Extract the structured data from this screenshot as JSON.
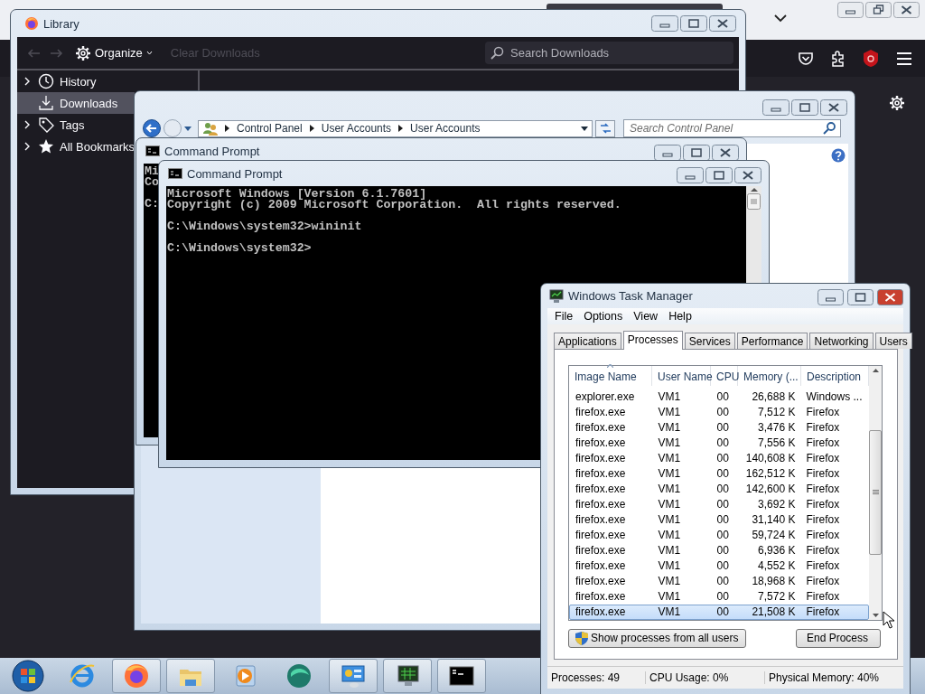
{
  "library": {
    "title": "Library",
    "toolbar": {
      "organize": {
        "label": "Organize"
      },
      "clear_downloads": {
        "label": "Clear Downloads",
        "disabled": true
      }
    },
    "search": {
      "placeholder": "Search Downloads"
    },
    "sidebar": {
      "items": [
        {
          "label": "History",
          "kind": "history",
          "expandable": true,
          "selected": false
        },
        {
          "label": "Downloads",
          "kind": "downloads",
          "expandable": false,
          "selected": true
        },
        {
          "label": "Tags",
          "kind": "tags",
          "expandable": true,
          "selected": false
        },
        {
          "label": "All Bookmarks",
          "kind": "bookmarks",
          "expandable": true,
          "selected": false
        }
      ]
    }
  },
  "control_panel": {
    "breadcrumb": [
      "Control Panel",
      "User Accounts",
      "User Accounts"
    ],
    "search": {
      "placeholder": "Search Control Panel"
    }
  },
  "command_prompts": [
    {
      "title": "Command Prompt",
      "paragraphs": [
        [
          "Mi",
          "Co"
        ],
        [
          "C:"
        ]
      ]
    },
    {
      "title": "Command Prompt",
      "paragraphs": [
        [
          "Microsoft Windows [Version 6.1.7601]",
          "Copyright (c) 2009 Microsoft Corporation.  All rights reserved."
        ],
        [
          "C:\\Windows\\system32>wininit"
        ],
        [
          "C:\\Windows\\system32>"
        ]
      ]
    }
  ],
  "task_manager": {
    "title": "Windows Task Manager",
    "menu": [
      "File",
      "Options",
      "View",
      "Help"
    ],
    "tabs": [
      {
        "label": "Applications",
        "selected": false
      },
      {
        "label": "Processes",
        "selected": true
      },
      {
        "label": "Services",
        "selected": false
      },
      {
        "label": "Performance",
        "selected": false
      },
      {
        "label": "Networking",
        "selected": false
      },
      {
        "label": "Users",
        "selected": false
      }
    ],
    "table": {
      "columns": [
        {
          "label": "Image Name",
          "sorted": true
        },
        {
          "label": "User Name",
          "sorted": false
        },
        {
          "label": "CPU",
          "sorted": false
        },
        {
          "label": "Memory (...",
          "sorted": false
        },
        {
          "label": "Description",
          "sorted": false
        }
      ],
      "rows": [
        {
          "cells": [
            "explorer.exe",
            "VM1",
            "00",
            "26,688 K",
            "Windows ..."
          ],
          "selected": false
        },
        {
          "cells": [
            "firefox.exe",
            "VM1",
            "00",
            "7,512 K",
            "Firefox"
          ],
          "selected": false
        },
        {
          "cells": [
            "firefox.exe",
            "VM1",
            "00",
            "3,476 K",
            "Firefox"
          ],
          "selected": false
        },
        {
          "cells": [
            "firefox.exe",
            "VM1",
            "00",
            "7,556 K",
            "Firefox"
          ],
          "selected": false
        },
        {
          "cells": [
            "firefox.exe",
            "VM1",
            "00",
            "140,608 K",
            "Firefox"
          ],
          "selected": false
        },
        {
          "cells": [
            "firefox.exe",
            "VM1",
            "00",
            "162,512 K",
            "Firefox"
          ],
          "selected": false
        },
        {
          "cells": [
            "firefox.exe",
            "VM1",
            "00",
            "142,600 K",
            "Firefox"
          ],
          "selected": false
        },
        {
          "cells": [
            "firefox.exe",
            "VM1",
            "00",
            "3,692 K",
            "Firefox"
          ],
          "selected": false
        },
        {
          "cells": [
            "firefox.exe",
            "VM1",
            "00",
            "31,140 K",
            "Firefox"
          ],
          "selected": false
        },
        {
          "cells": [
            "firefox.exe",
            "VM1",
            "00",
            "59,724 K",
            "Firefox"
          ],
          "selected": false
        },
        {
          "cells": [
            "firefox.exe",
            "VM1",
            "00",
            "6,936 K",
            "Firefox"
          ],
          "selected": false
        },
        {
          "cells": [
            "firefox.exe",
            "VM1",
            "00",
            "4,552 K",
            "Firefox"
          ],
          "selected": false
        },
        {
          "cells": [
            "firefox.exe",
            "VM1",
            "00",
            "18,968 K",
            "Firefox"
          ],
          "selected": false
        },
        {
          "cells": [
            "firefox.exe",
            "VM1",
            "00",
            "7,572 K",
            "Firefox"
          ],
          "selected": false
        },
        {
          "cells": [
            "firefox.exe",
            "VM1",
            "00",
            "21,508 K",
            "Firefox"
          ],
          "selected": true
        }
      ]
    },
    "buttons": [
      {
        "label": "Show processes from all users",
        "kind": "shield"
      },
      {
        "label": "End Process",
        "kind": "plain"
      }
    ],
    "status_bar": [
      "Processes: 49",
      "CPU Usage: 0%",
      "Physical Memory: 40%"
    ]
  },
  "taskbar": {
    "items": [
      {
        "kind": "start"
      },
      {
        "kind": "internet-explorer",
        "running": false
      },
      {
        "kind": "firefox",
        "running": true
      },
      {
        "kind": "file-explorer",
        "running": true
      },
      {
        "kind": "media-player",
        "running": false
      },
      {
        "kind": "green-app",
        "running": false
      },
      {
        "kind": "control-panel",
        "running": true
      },
      {
        "kind": "task-manager",
        "running": true
      },
      {
        "kind": "cmd",
        "running": true
      }
    ]
  }
}
